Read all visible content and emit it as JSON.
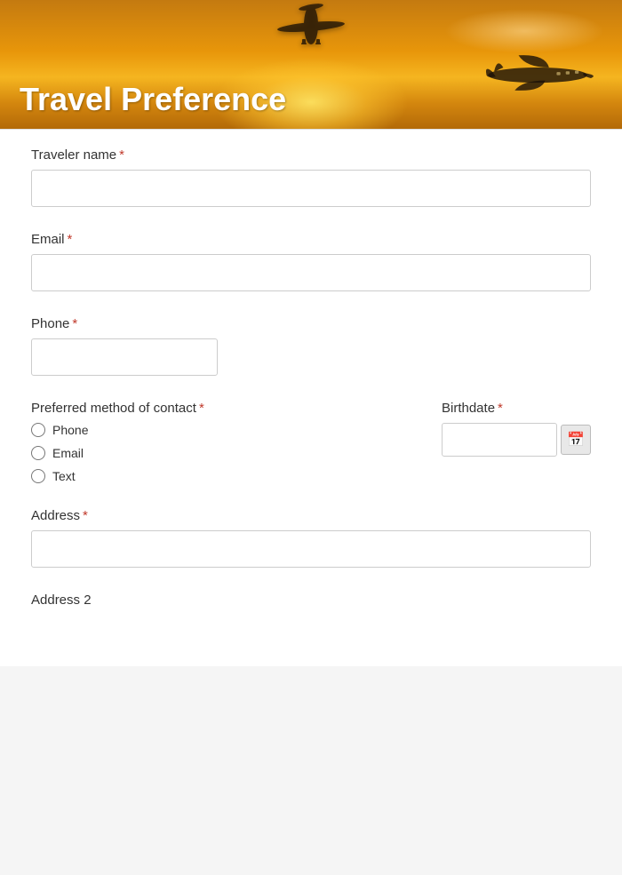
{
  "header": {
    "title": "Travel Preference"
  },
  "form": {
    "fields": {
      "traveler_name": {
        "label": "Traveler name",
        "placeholder": "",
        "required": true
      },
      "email": {
        "label": "Email",
        "placeholder": "",
        "required": true
      },
      "phone": {
        "label": "Phone",
        "placeholder": "",
        "required": true
      },
      "preferred_contact": {
        "label": "Preferred method of contact",
        "required": true,
        "options": [
          "Phone",
          "Email",
          "Text"
        ]
      },
      "birthdate": {
        "label": "Birthdate",
        "required": true,
        "placeholder": ""
      },
      "address": {
        "label": "Address",
        "placeholder": "",
        "required": true
      },
      "address2": {
        "label": "Address 2"
      }
    },
    "required_indicator": "*",
    "calendar_icon": "📅"
  }
}
